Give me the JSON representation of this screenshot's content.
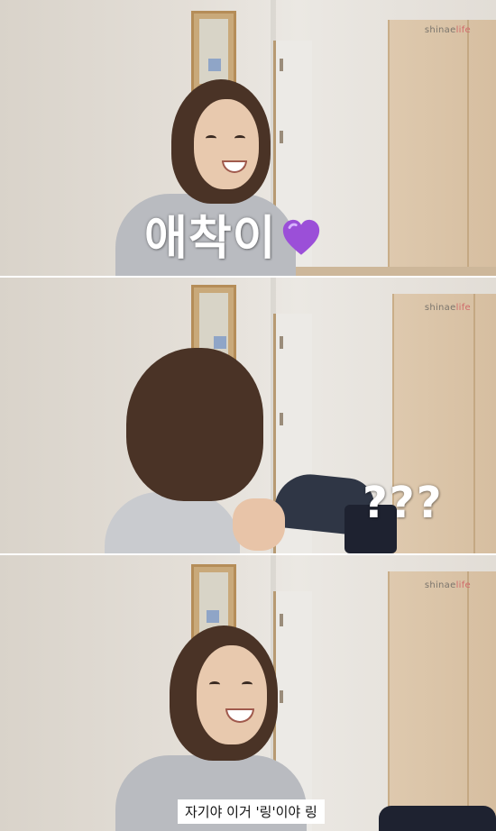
{
  "watermark": {
    "text_main": "shinae",
    "text_accent": "life",
    "accent_color": "#d06a6a"
  },
  "frames": [
    {
      "caption": "애착이",
      "caption_icon": "purple-heart-icon",
      "heart_color": "#9b4fd8"
    },
    {
      "caption": "???"
    },
    {
      "subtitle": "자기야 이거 '링'이야 링"
    }
  ]
}
